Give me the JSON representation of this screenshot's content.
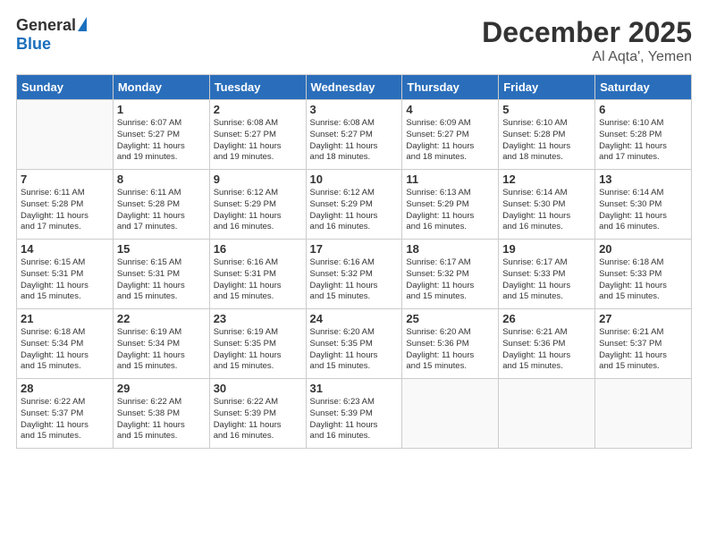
{
  "header": {
    "logo_general": "General",
    "logo_blue": "Blue",
    "title": "December 2025",
    "subtitle": "Al Aqta', Yemen"
  },
  "days_of_week": [
    "Sunday",
    "Monday",
    "Tuesday",
    "Wednesday",
    "Thursday",
    "Friday",
    "Saturday"
  ],
  "weeks": [
    [
      {
        "day": "",
        "info": ""
      },
      {
        "day": "1",
        "info": "Sunrise: 6:07 AM\nSunset: 5:27 PM\nDaylight: 11 hours\nand 19 minutes."
      },
      {
        "day": "2",
        "info": "Sunrise: 6:08 AM\nSunset: 5:27 PM\nDaylight: 11 hours\nand 19 minutes."
      },
      {
        "day": "3",
        "info": "Sunrise: 6:08 AM\nSunset: 5:27 PM\nDaylight: 11 hours\nand 18 minutes."
      },
      {
        "day": "4",
        "info": "Sunrise: 6:09 AM\nSunset: 5:27 PM\nDaylight: 11 hours\nand 18 minutes."
      },
      {
        "day": "5",
        "info": "Sunrise: 6:10 AM\nSunset: 5:28 PM\nDaylight: 11 hours\nand 18 minutes."
      },
      {
        "day": "6",
        "info": "Sunrise: 6:10 AM\nSunset: 5:28 PM\nDaylight: 11 hours\nand 17 minutes."
      }
    ],
    [
      {
        "day": "7",
        "info": "Sunrise: 6:11 AM\nSunset: 5:28 PM\nDaylight: 11 hours\nand 17 minutes."
      },
      {
        "day": "8",
        "info": "Sunrise: 6:11 AM\nSunset: 5:28 PM\nDaylight: 11 hours\nand 17 minutes."
      },
      {
        "day": "9",
        "info": "Sunrise: 6:12 AM\nSunset: 5:29 PM\nDaylight: 11 hours\nand 16 minutes."
      },
      {
        "day": "10",
        "info": "Sunrise: 6:12 AM\nSunset: 5:29 PM\nDaylight: 11 hours\nand 16 minutes."
      },
      {
        "day": "11",
        "info": "Sunrise: 6:13 AM\nSunset: 5:29 PM\nDaylight: 11 hours\nand 16 minutes."
      },
      {
        "day": "12",
        "info": "Sunrise: 6:14 AM\nSunset: 5:30 PM\nDaylight: 11 hours\nand 16 minutes."
      },
      {
        "day": "13",
        "info": "Sunrise: 6:14 AM\nSunset: 5:30 PM\nDaylight: 11 hours\nand 16 minutes."
      }
    ],
    [
      {
        "day": "14",
        "info": "Sunrise: 6:15 AM\nSunset: 5:31 PM\nDaylight: 11 hours\nand 15 minutes."
      },
      {
        "day": "15",
        "info": "Sunrise: 6:15 AM\nSunset: 5:31 PM\nDaylight: 11 hours\nand 15 minutes."
      },
      {
        "day": "16",
        "info": "Sunrise: 6:16 AM\nSunset: 5:31 PM\nDaylight: 11 hours\nand 15 minutes."
      },
      {
        "day": "17",
        "info": "Sunrise: 6:16 AM\nSunset: 5:32 PM\nDaylight: 11 hours\nand 15 minutes."
      },
      {
        "day": "18",
        "info": "Sunrise: 6:17 AM\nSunset: 5:32 PM\nDaylight: 11 hours\nand 15 minutes."
      },
      {
        "day": "19",
        "info": "Sunrise: 6:17 AM\nSunset: 5:33 PM\nDaylight: 11 hours\nand 15 minutes."
      },
      {
        "day": "20",
        "info": "Sunrise: 6:18 AM\nSunset: 5:33 PM\nDaylight: 11 hours\nand 15 minutes."
      }
    ],
    [
      {
        "day": "21",
        "info": "Sunrise: 6:18 AM\nSunset: 5:34 PM\nDaylight: 11 hours\nand 15 minutes."
      },
      {
        "day": "22",
        "info": "Sunrise: 6:19 AM\nSunset: 5:34 PM\nDaylight: 11 hours\nand 15 minutes."
      },
      {
        "day": "23",
        "info": "Sunrise: 6:19 AM\nSunset: 5:35 PM\nDaylight: 11 hours\nand 15 minutes."
      },
      {
        "day": "24",
        "info": "Sunrise: 6:20 AM\nSunset: 5:35 PM\nDaylight: 11 hours\nand 15 minutes."
      },
      {
        "day": "25",
        "info": "Sunrise: 6:20 AM\nSunset: 5:36 PM\nDaylight: 11 hours\nand 15 minutes."
      },
      {
        "day": "26",
        "info": "Sunrise: 6:21 AM\nSunset: 5:36 PM\nDaylight: 11 hours\nand 15 minutes."
      },
      {
        "day": "27",
        "info": "Sunrise: 6:21 AM\nSunset: 5:37 PM\nDaylight: 11 hours\nand 15 minutes."
      }
    ],
    [
      {
        "day": "28",
        "info": "Sunrise: 6:22 AM\nSunset: 5:37 PM\nDaylight: 11 hours\nand 15 minutes."
      },
      {
        "day": "29",
        "info": "Sunrise: 6:22 AM\nSunset: 5:38 PM\nDaylight: 11 hours\nand 15 minutes."
      },
      {
        "day": "30",
        "info": "Sunrise: 6:22 AM\nSunset: 5:39 PM\nDaylight: 11 hours\nand 16 minutes."
      },
      {
        "day": "31",
        "info": "Sunrise: 6:23 AM\nSunset: 5:39 PM\nDaylight: 11 hours\nand 16 minutes."
      },
      {
        "day": "",
        "info": ""
      },
      {
        "day": "",
        "info": ""
      },
      {
        "day": "",
        "info": ""
      }
    ]
  ]
}
